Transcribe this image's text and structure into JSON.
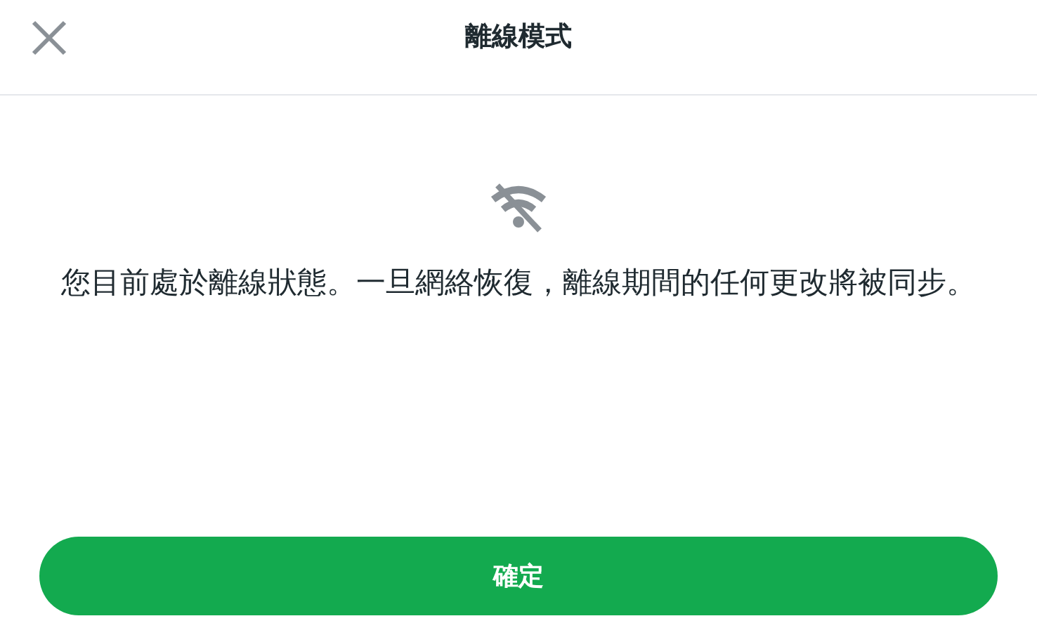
{
  "dialog": {
    "title": "離線模式",
    "message": "您目前處於離線狀態。一旦網絡恢復，離線期間的任何更改將被同步。",
    "button": "確定"
  }
}
